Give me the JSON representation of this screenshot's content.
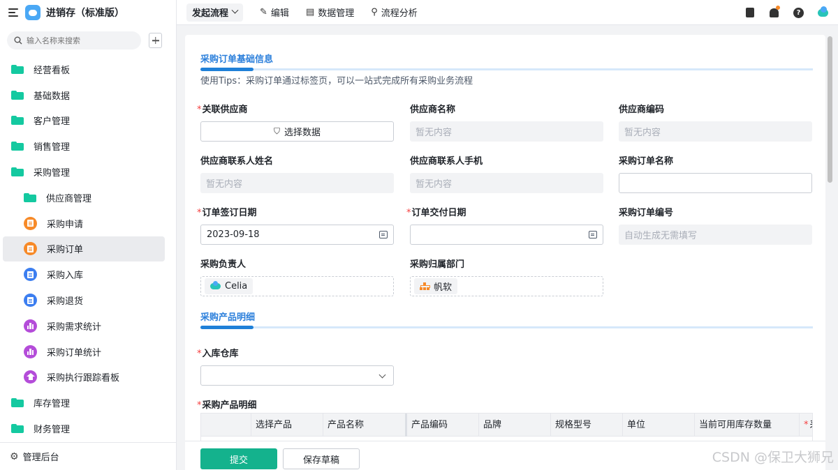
{
  "app": {
    "title": "进销存（标准版）"
  },
  "search": {
    "placeholder": "输入名称来搜索"
  },
  "sidebar": {
    "items": [
      {
        "label": "经营看板"
      },
      {
        "label": "基础数据"
      },
      {
        "label": "客户管理"
      },
      {
        "label": "销售管理"
      },
      {
        "label": "采购管理"
      },
      {
        "label": "供应商管理"
      },
      {
        "label": "采购申请"
      },
      {
        "label": "采购订单"
      },
      {
        "label": "采购入库"
      },
      {
        "label": "采购退货"
      },
      {
        "label": "采购需求统计"
      },
      {
        "label": "采购订单统计"
      },
      {
        "label": "采购执行跟踪看板"
      },
      {
        "label": "库存管理"
      },
      {
        "label": "财务管理"
      }
    ],
    "footer": "管理后台"
  },
  "topbar": {
    "launch": "发起流程",
    "edit": "编辑",
    "data_manage": "数据管理",
    "flow_analysis": "流程分析"
  },
  "form": {
    "section1": "采购订单基础信息",
    "tips": "使用Tips：采购订单通过标签页，可以一站式完成所有采购业务流程",
    "fields": {
      "supplier": {
        "label": "关联供应商",
        "button": "选择数据"
      },
      "supplier_name": {
        "label": "供应商名称",
        "value": "暂无内容"
      },
      "supplier_code": {
        "label": "供应商编码",
        "value": "暂无内容"
      },
      "contact_name": {
        "label": "供应商联系人姓名",
        "value": "暂无内容"
      },
      "contact_phone": {
        "label": "供应商联系人手机",
        "value": "暂无内容"
      },
      "order_name": {
        "label": "采购订单名称",
        "value": ""
      },
      "sign_date": {
        "label": "订单签订日期",
        "value": "2023-09-18"
      },
      "delivery_date": {
        "label": "订单交付日期",
        "value": ""
      },
      "order_no": {
        "label": "采购订单编号",
        "value": "自动生成无需填写"
      },
      "owner": {
        "label": "采购负责人",
        "value": "Celia"
      },
      "department": {
        "label": "采购归属部门",
        "value": "帆软"
      }
    },
    "section2": "采购产品明细",
    "warehouse": {
      "label": "入库仓库",
      "value": ""
    },
    "detail_label": "采购产品明细",
    "table_headers": [
      "",
      "选择产品",
      "产品名称",
      "产品编码",
      "品牌",
      "规格型号",
      "单位",
      "当前可用库存数量",
      "采"
    ]
  },
  "footer": {
    "submit": "提交",
    "save_draft": "保存草稿"
  },
  "watermark": "CSDN @保卫大狮兄"
}
